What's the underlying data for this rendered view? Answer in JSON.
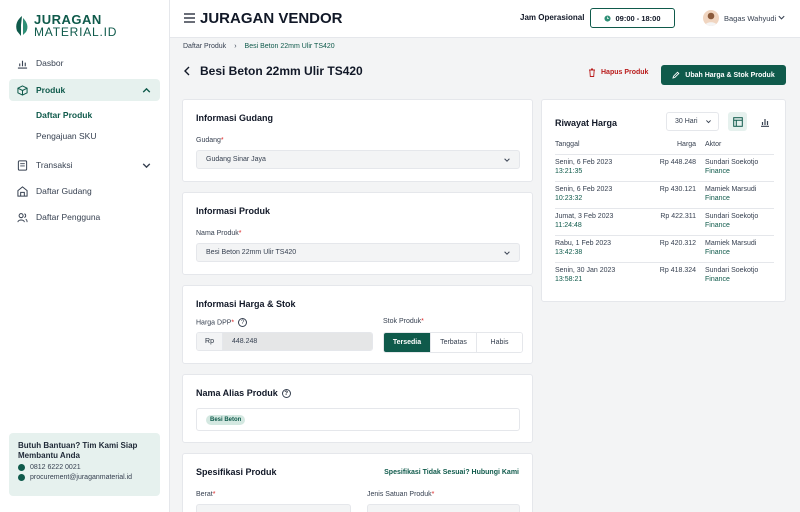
{
  "sidebar": {
    "logo_line1": "JURAGAN",
    "logo_line2": "MATERIAL.ID",
    "items": [
      {
        "label": "Dasbor"
      },
      {
        "label": "Produk"
      },
      {
        "label": "Transaksi"
      },
      {
        "label": "Daftar Gudang"
      },
      {
        "label": "Daftar Pengguna"
      }
    ],
    "sub_items": [
      {
        "label": "Daftar Produk"
      },
      {
        "label": "Pengajuan SKU"
      }
    ],
    "help": {
      "title": "Butuh Bantuan? Tim Kami Siap Membantu Anda",
      "phone": "0812 6222 0021",
      "email": "procurement@juraganmaterial.id"
    }
  },
  "header": {
    "title": "JURAGAN VENDOR",
    "jam_label": "Jam Operasional",
    "jam_value": "09:00 - 18:00",
    "user_name": "Bagas Wahyudi"
  },
  "breadcrumb": {
    "parent": "Daftar Produk",
    "current": "Besi Beton 22mm Ulir TS420"
  },
  "page": {
    "title": "Besi Beton 22mm Ulir TS420",
    "delete_label": "Hapus Produk",
    "edit_label": "Ubah Harga & Stok Produk"
  },
  "gudang": {
    "title": "Informasi Gudang",
    "label": "Gudang",
    "value": "Gudang Sinar Jaya"
  },
  "produk": {
    "title": "Informasi Produk",
    "label": "Nama Produk",
    "value": "Besi Beton 22mm Ulir TS420"
  },
  "harga_stok": {
    "title": "Informasi Harga & Stok",
    "harga_label": "Harga DPP",
    "currency": "Rp",
    "harga_value": "448.248",
    "stok_label": "Stok Produk",
    "stok_options": [
      "Tersedia",
      "Terbatas",
      "Habis"
    ],
    "stok_selected": "Tersedia"
  },
  "alias": {
    "title": "Nama Alias Produk",
    "chips": [
      "Besi Beton"
    ]
  },
  "spesifikasi": {
    "title": "Spesifikasi Produk",
    "link": "Spesifikasi Tidak Sesuai? Hubungi Kami",
    "berat_label": "Berat",
    "jenis_label": "Jenis Satuan Produk"
  },
  "riwayat": {
    "title": "Riwayat Harga",
    "period": "30 Hari",
    "headers": {
      "date": "Tanggal",
      "price": "Harga",
      "actor": "Aktor"
    },
    "rows": [
      {
        "date": "Senin, 6 Feb 2023",
        "time": "13:21:35",
        "price": "Rp 448.248",
        "actor": "Sundari Soekotjo",
        "role": "Finance"
      },
      {
        "date": "Senin, 6 Feb 2023",
        "time": "10:23:32",
        "price": "Rp 430.121",
        "actor": "Mamiek Marsudi",
        "role": "Finance"
      },
      {
        "date": "Jumat, 3 Feb 2023",
        "time": "11:24:48",
        "price": "Rp 422.311",
        "actor": "Sundari Soekotjo",
        "role": "Finance"
      },
      {
        "date": "Rabu, 1 Feb 2023",
        "time": "13:42:38",
        "price": "Rp 420.312",
        "actor": "Mamiek Marsudi",
        "role": "Finance"
      },
      {
        "date": "Senin, 30 Jan 2023",
        "time": "13:58:21",
        "price": "Rp 418.324",
        "actor": "Sundari Soekotjo",
        "role": "Finance"
      }
    ]
  },
  "colors": {
    "primary": "#0f5a4b",
    "danger": "#b91c1c",
    "accent_bg": "#e6f1ee"
  }
}
